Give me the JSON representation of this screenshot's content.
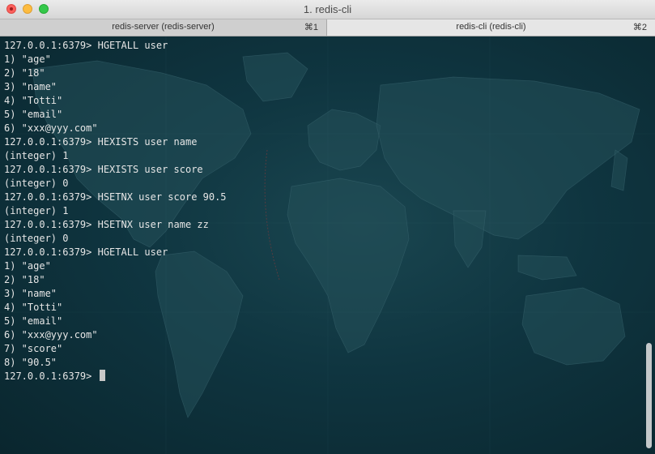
{
  "window": {
    "title": "1. redis-cli"
  },
  "tabs": [
    {
      "label": "redis-server (redis-server)",
      "shortcut": "⌘1"
    },
    {
      "label": "redis-cli (redis-cli)",
      "shortcut": "⌘2"
    }
  ],
  "terminal": {
    "lines": [
      "127.0.0.1:6379> HGETALL user",
      "1) \"age\"",
      "2) \"18\"",
      "3) \"name\"",
      "4) \"Totti\"",
      "5) \"email\"",
      "6) \"xxx@yyy.com\"",
      "127.0.0.1:6379> HEXISTS user name",
      "(integer) 1",
      "127.0.0.1:6379> HEXISTS user score",
      "(integer) 0",
      "127.0.0.1:6379> HSETNX user score 90.5",
      "(integer) 1",
      "127.0.0.1:6379> HSETNX user name zz",
      "(integer) 0",
      "127.0.0.1:6379> HGETALL user",
      "1) \"age\"",
      "2) \"18\"",
      "3) \"name\"",
      "4) \"Totti\"",
      "5) \"email\"",
      "6) \"xxx@yyy.com\"",
      "7) \"score\"",
      "8) \"90.5\""
    ],
    "prompt": "127.0.0.1:6379> "
  },
  "colors": {
    "background": "#0c2a33",
    "text": "#e6e6e6",
    "close": "#fc605c",
    "minimize": "#fdbc40",
    "maximize": "#34c84a"
  }
}
